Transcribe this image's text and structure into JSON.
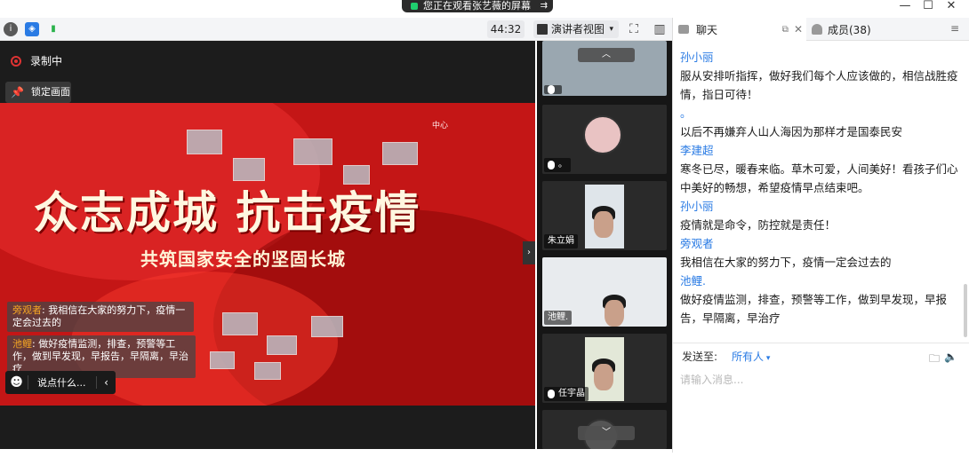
{
  "share_banner": {
    "text": "您正在观看张艺薇的屏幕",
    "end_icon": "⇉"
  },
  "window_controls": {
    "minimize": "—",
    "maximize": "☐",
    "close": "✕"
  },
  "toolbar": {
    "info_icon": "i",
    "shield_icon": "◈",
    "signal_icon": "▮",
    "timer": "44:32",
    "presenter_view": "演讲者视图",
    "presenter_view_chevron": "▾",
    "fullscreen_icon": "⛶",
    "sidebar_icon": "▥"
  },
  "main": {
    "recording_label": "录制中",
    "lock_label": "锁定画面",
    "poster": {
      "center_text": "中心",
      "title": "众志成城 抗击疫情",
      "subtitle": "共筑国家安全的坚固长城"
    },
    "danmu": [
      {
        "name": "旁观者",
        "text": "我相信在大家的努力下，疫情一定会过去的"
      },
      {
        "name": "池鲤",
        "text": "做好疫情监测，排查，预警等工作，做到早发现，早报告，早隔离，早治疗"
      }
    ],
    "say_box": {
      "emoji_icon": "☻",
      "placeholder": "说点什么...",
      "collapse_icon": "‹"
    },
    "side_collapse_icon": "›"
  },
  "video_strip": {
    "up_icon": "︿",
    "down_icon": "﹀",
    "tiles": [
      {
        "label": ""
      },
      {
        "label": "。"
      },
      {
        "label": "朱立娟"
      },
      {
        "label": "池鲤."
      },
      {
        "label": "任宇晶"
      }
    ]
  },
  "right_panel": {
    "tab_chat": "聊天",
    "tab_chat_pop": "⧉",
    "tab_chat_close": "✕",
    "tab_members": "成员(38)",
    "menu_icon": "≡",
    "messages": [
      {
        "name": "孙小丽",
        "text": "服从安排听指挥，做好我们每个人应该做的，相信战胜疫情，指日可待！"
      },
      {
        "name": "。",
        "text": "以后不再嫌弃人山人海因为那样才是国泰民安"
      },
      {
        "name": "李建超",
        "text": "寒冬已尽，暖春来临。草木可爱，人间美好！看孩子们心中美好的畅想，希望疫情早点结束吧。"
      },
      {
        "name": "孙小丽",
        "text": "疫情就是命令，防控就是责任！"
      },
      {
        "name": "旁观者",
        "text": "我相信在大家的努力下，疫情一定会过去的"
      },
      {
        "name": "池鲤.",
        "text": "做好疫情监测，排查，预警等工作，做到早发现，早报告，早隔离，早治疗"
      }
    ],
    "send_to_label": "发送至:",
    "send_to_value": "所有人",
    "folder_icon": "🗀",
    "volume_icon": "🔈",
    "input_placeholder": "请输入消息..."
  }
}
